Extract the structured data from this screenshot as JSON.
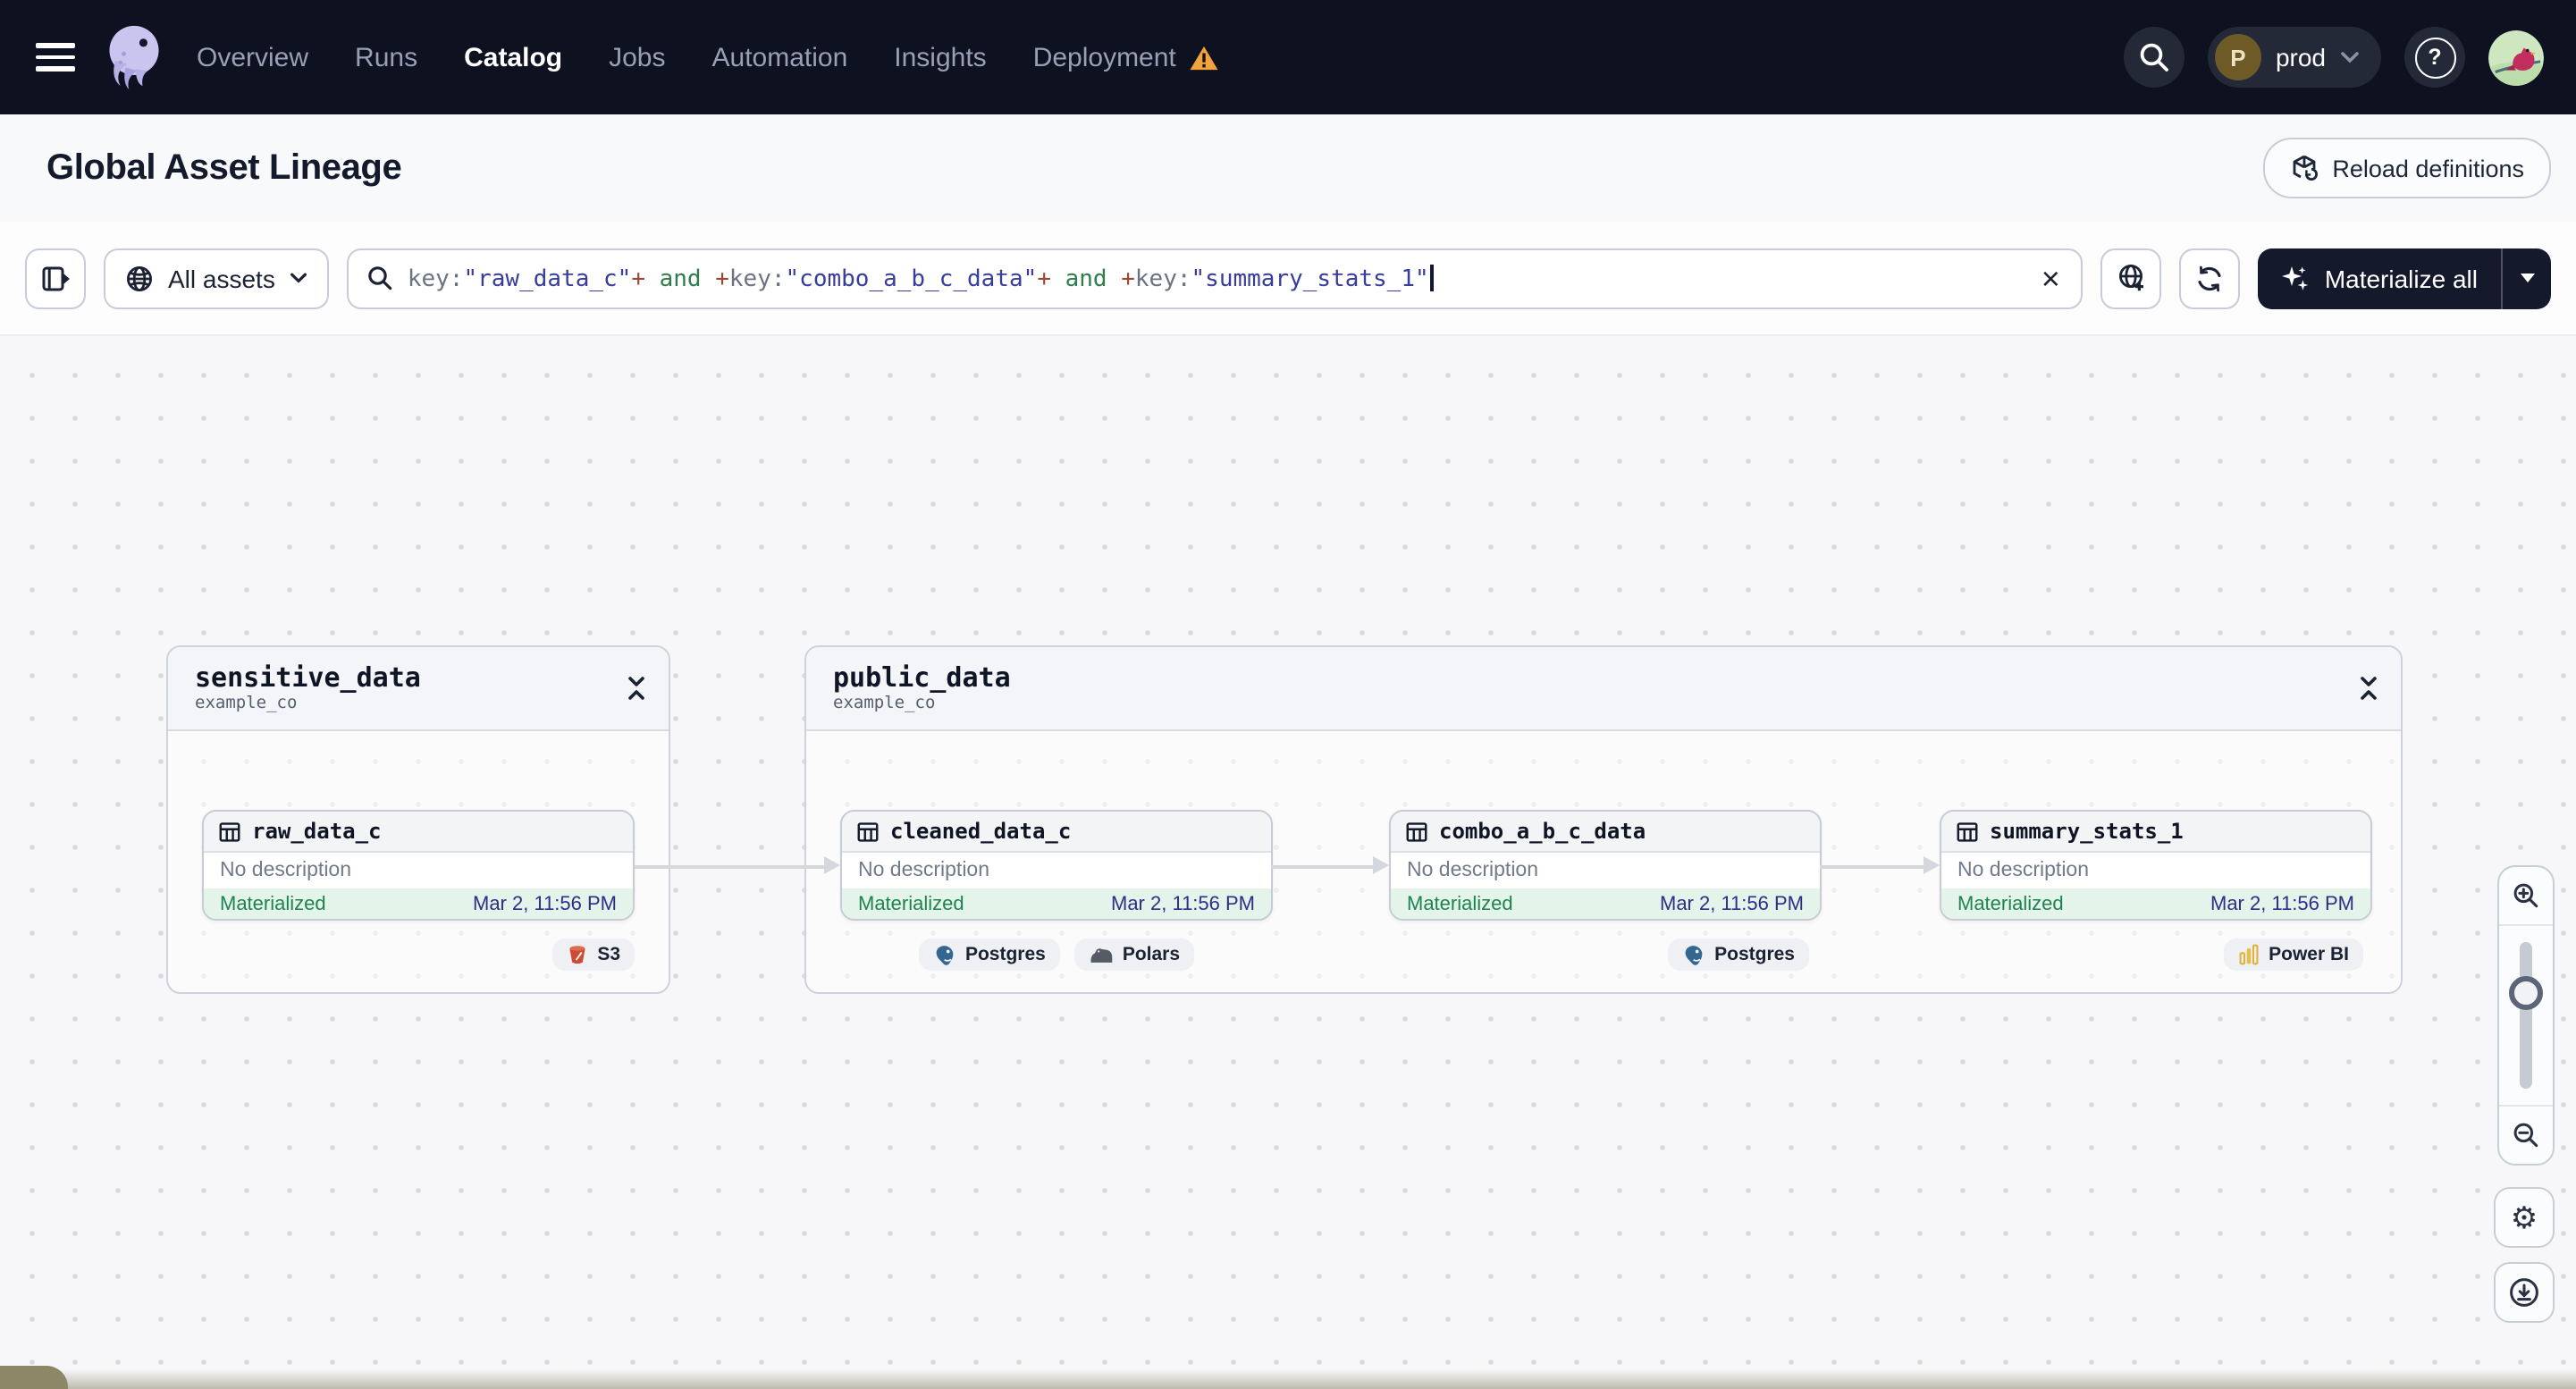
{
  "nav": {
    "items": [
      {
        "label": "Overview",
        "active": false,
        "warning": false
      },
      {
        "label": "Runs",
        "active": false,
        "warning": false
      },
      {
        "label": "Catalog",
        "active": true,
        "warning": false
      },
      {
        "label": "Jobs",
        "active": false,
        "warning": false
      },
      {
        "label": "Automation",
        "active": false,
        "warning": false
      },
      {
        "label": "Insights",
        "active": false,
        "warning": false
      },
      {
        "label": "Deployment",
        "active": false,
        "warning": true
      }
    ],
    "environment": {
      "initial": "P",
      "label": "prod"
    }
  },
  "page_header": {
    "title": "Global Asset Lineage",
    "reload_label": "Reload definitions"
  },
  "toolbar": {
    "scope": {
      "label": "All assets"
    },
    "search": {
      "tokens": [
        {
          "t": "key:",
          "c": "key"
        },
        {
          "t": "\"raw_data_c\"",
          "c": "value"
        },
        {
          "t": "+",
          "c": "op"
        },
        {
          "t": " and ",
          "c": "bool"
        },
        {
          "t": "+",
          "c": "op"
        },
        {
          "t": "key:",
          "c": "key"
        },
        {
          "t": "\"combo_a_b_c_data\"",
          "c": "value"
        },
        {
          "t": "+",
          "c": "op"
        },
        {
          "t": " and ",
          "c": "bool"
        },
        {
          "t": "+",
          "c": "op"
        },
        {
          "t": "key:",
          "c": "key"
        },
        {
          "t": "\"summary_stats_1\"",
          "c": "value"
        }
      ]
    },
    "materialize": {
      "label": "Materialize all"
    }
  },
  "graph": {
    "groups": [
      {
        "name": "sensitive_data",
        "location": "example_co",
        "assets": [
          "raw_data_c"
        ]
      },
      {
        "name": "public_data",
        "location": "example_co",
        "assets": [
          "cleaned_data_c",
          "combo_a_b_c_data",
          "summary_stats_1"
        ]
      }
    ],
    "assets": [
      {
        "name": "raw_data_c",
        "description": "No description",
        "status": "Materialized",
        "materialized_at": "Mar 2, 11:56 PM",
        "tags": [
          "S3"
        ]
      },
      {
        "name": "cleaned_data_c",
        "description": "No description",
        "status": "Materialized",
        "materialized_at": "Mar 2, 11:56 PM",
        "tags": [
          "Postgres",
          "Polars"
        ]
      },
      {
        "name": "combo_a_b_c_data",
        "description": "No description",
        "status": "Materialized",
        "materialized_at": "Mar 2, 11:56 PM",
        "tags": [
          "Postgres"
        ]
      },
      {
        "name": "summary_stats_1",
        "description": "No description",
        "status": "Materialized",
        "materialized_at": "Mar 2, 11:56 PM",
        "tags": [
          "Power BI"
        ]
      }
    ]
  },
  "colors": {
    "nav_bg": "#0d1120",
    "warning": "#f2a33c",
    "status_green": "#1d8450",
    "timestamp_blue": "#2b2f87",
    "query_value": "#383d9b",
    "query_operator": "#9c4732",
    "query_boolean": "#2e7d4a",
    "edge": "#d4d7dc"
  }
}
